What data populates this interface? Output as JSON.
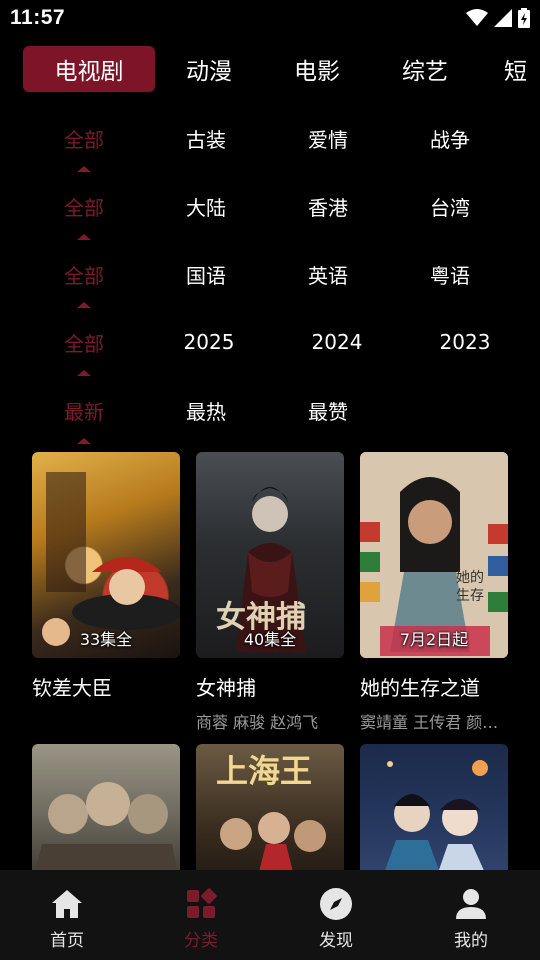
{
  "status_bar": {
    "time": "11:57"
  },
  "top_tabs": [
    {
      "label": "电视剧",
      "active": true
    },
    {
      "label": "动漫",
      "active": false
    },
    {
      "label": "电影",
      "active": false
    },
    {
      "label": "综艺",
      "active": false
    },
    {
      "label": "短",
      "active": false
    }
  ],
  "filters": [
    {
      "selected": "全部",
      "options": [
        "古装",
        "爱情",
        "战争"
      ]
    },
    {
      "selected": "全部",
      "options": [
        "大陆",
        "香港",
        "台湾"
      ]
    },
    {
      "selected": "全部",
      "options": [
        "国语",
        "英语",
        "粤语"
      ]
    },
    {
      "selected": "全部",
      "options": [
        "2025",
        "2024",
        "2023"
      ]
    },
    {
      "selected": "最新",
      "options": [
        "最热",
        "最赞"
      ]
    }
  ],
  "cards": [
    {
      "title": "钦差大臣",
      "badge": "33集全",
      "cast": ""
    },
    {
      "title": "女神捕",
      "badge": "40集全",
      "cast": "商蓉 麻骏 赵鸿飞"
    },
    {
      "title": "她的生存之道",
      "badge": "7月2日起",
      "cast": "窦靖童 王传君 颜…"
    }
  ],
  "bottom_nav": [
    {
      "label": "首页",
      "icon": "home-icon",
      "active": false
    },
    {
      "label": "分类",
      "icon": "category-icon",
      "active": true
    },
    {
      "label": "发现",
      "icon": "compass-icon",
      "active": false
    },
    {
      "label": "我的",
      "icon": "profile-icon",
      "active": false
    }
  ],
  "colors": {
    "accent": "#7c1b2c",
    "active_tab_bg": "#7d1428",
    "background": "#000000",
    "nav_bg": "#121212"
  }
}
